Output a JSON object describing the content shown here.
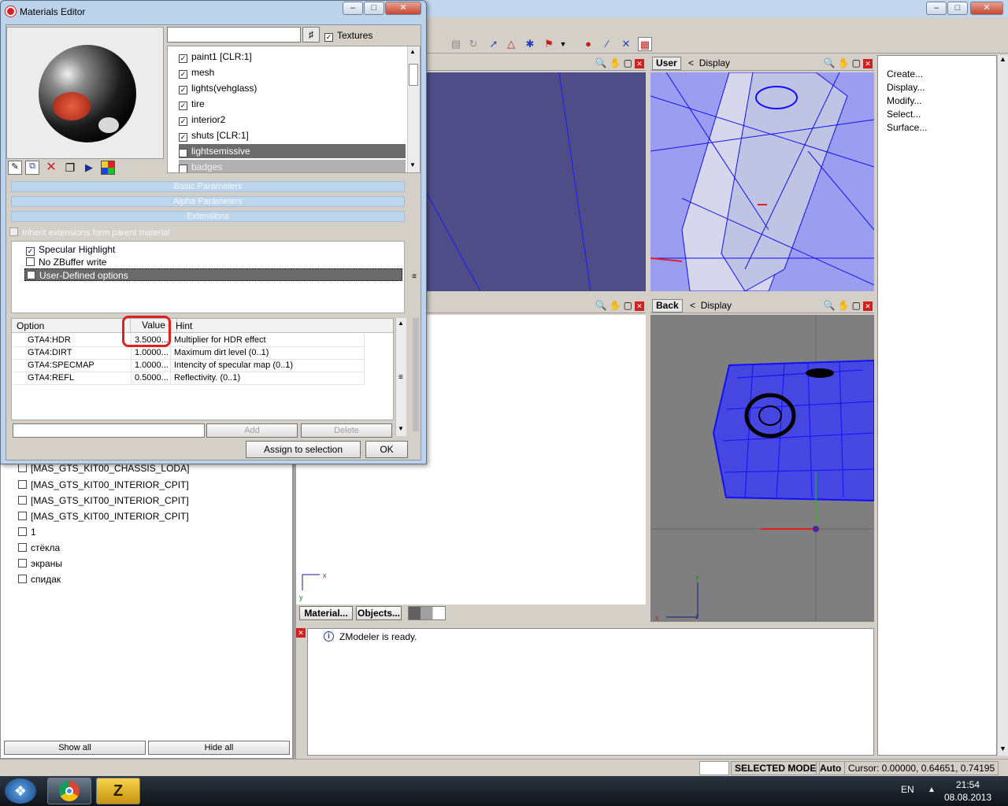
{
  "materials_editor": {
    "title": "Materials Editor",
    "search_value": "",
    "textures_label": "Textures",
    "materials": [
      {
        "label": "paint1 [CLR:1]",
        "checked": true,
        "selected": false
      },
      {
        "label": "mesh",
        "checked": true,
        "selected": false
      },
      {
        "label": "lights(vehglass)",
        "checked": true,
        "selected": false
      },
      {
        "label": "tire",
        "checked": true,
        "selected": false
      },
      {
        "label": "interior2",
        "checked": true,
        "selected": false
      },
      {
        "label": "shuts [CLR:1]",
        "checked": true,
        "selected": false
      },
      {
        "label": "lightsemissive",
        "checked": true,
        "selected": true
      },
      {
        "label": "badges",
        "checked": true,
        "selected": false
      }
    ],
    "sections": {
      "basic": "Basic Parameters",
      "alpha": "Alpha Parameters",
      "extensions": "Extensions"
    },
    "inherit_label": "Inherit extensions form parent material",
    "options": [
      {
        "label": "Specular Highlight",
        "checked": true
      },
      {
        "label": "No ZBuffer write",
        "checked": false
      },
      {
        "label": "User-Defined options",
        "checked": false
      }
    ],
    "grid": {
      "headers": {
        "option": "Option",
        "value": "Value",
        "hint": "Hint"
      },
      "rows": [
        {
          "option": "GTA4:HDR",
          "value": "3.5000...",
          "hint": "Multiplier for HDR effect"
        },
        {
          "option": "GTA4:DIRT",
          "value": "1.0000...",
          "hint": "Maximum dirt level (0..1)"
        },
        {
          "option": "GTA4:SPECMAP",
          "value": "1.0000...",
          "hint": "Intencity of specular map (0..1)"
        },
        {
          "option": "GTA4:REFL",
          "value": "0.5000...",
          "hint": "Reflectivity. (0..1)"
        }
      ]
    },
    "input_value": "",
    "add_label": "Add",
    "delete_label": "Delete",
    "assign_label": "Assign to selection",
    "ok_label": "OK"
  },
  "scene": {
    "items": [
      {
        "label": "[MAS_GTS_KIT00_CHASSIS_LODA]"
      },
      {
        "label": "[MAS_GTS_KIT00_INTERIOR_CPIT]"
      },
      {
        "label": "[MAS_GTS_KIT00_INTERIOR_CPIT]"
      },
      {
        "label": "[MAS_GTS_KIT00_INTERIOR_CPIT]"
      },
      {
        "label": "1"
      },
      {
        "label": "стёкла"
      },
      {
        "label": "экраны"
      },
      {
        "label": "спидак"
      }
    ],
    "show_all": "Show all",
    "hide_all": "Hide all"
  },
  "viewports": {
    "top_right_name": "User",
    "top_right_display": "Display",
    "bottom_right_name": "Back",
    "bottom_right_display": "Display"
  },
  "bottom_tabs": {
    "material": "Material...",
    "objects": "Objects..."
  },
  "commands": [
    "Create...",
    "Display...",
    "Modify...",
    "Select...",
    "Surface..."
  ],
  "log": {
    "message": "ZModeler is ready."
  },
  "status": {
    "mode": "SELECTED MODE",
    "auto": "Auto",
    "cursor": "Cursor: 0.00000, 0.64651, 0.74195"
  },
  "taskbar": {
    "lang": "EN",
    "time": "21:54",
    "date": "08.08.2013",
    "zmodeler_glyph": "Z"
  },
  "colors": {
    "accent_red": "#e02020",
    "wire_blue": "#1010ff",
    "selection": "#6b6b6b"
  }
}
